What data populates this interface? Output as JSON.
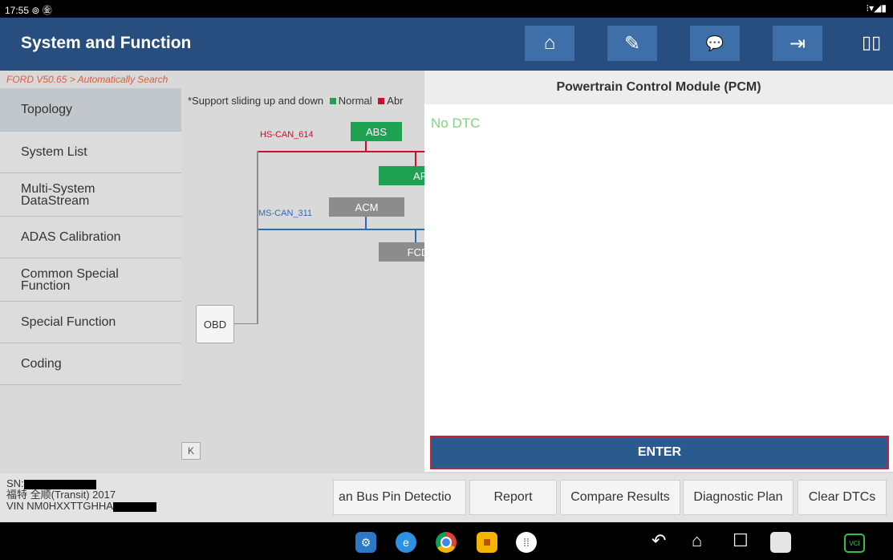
{
  "status_bar": {
    "time": "17:55 ⊚ ㊎",
    "indicators": "⁝▾◢▮"
  },
  "header": {
    "title": "System and Function",
    "buttons": [
      {
        "name": "home-icon",
        "glyph": "⌂"
      },
      {
        "name": "edit-icon",
        "glyph": "✎"
      },
      {
        "name": "chat-icon",
        "glyph": "💬"
      },
      {
        "name": "exit-icon",
        "glyph": "⇥"
      }
    ],
    "split_glyph": "▯▯"
  },
  "breadcrumb": "FORD V50.65 > Automatically Search",
  "sidebar": {
    "items": [
      {
        "label": "Topology"
      },
      {
        "label": "System List"
      },
      {
        "label": "Multi-System DataStream"
      },
      {
        "label": "ADAS Calibration"
      },
      {
        "label": "Common Special Function"
      },
      {
        "label": "Special Function"
      },
      {
        "label": "Coding"
      }
    ]
  },
  "topology": {
    "note": "*Support sliding up and down",
    "legend_normal": "Normal",
    "legend_abnormal": "Abr",
    "hs_can": "HS-CAN_614",
    "ms_can": "MS-CAN_311",
    "nodes": {
      "abs": "ABS",
      "api": "API",
      "acm": "ACM",
      "fcd": "FCDI",
      "obd": "OBD"
    },
    "collapse_label": "K",
    "colors": {
      "normal": "#1fa154",
      "abnormal": "#c8102e",
      "offline": "#8c8c8c",
      "hs_line": "#c8102e",
      "ms_line": "#2f6bb3"
    }
  },
  "panel": {
    "title": "Powertrain Control Module (PCM)",
    "status": "No DTC",
    "enter_label": "ENTER"
  },
  "vehicle": {
    "sn_label": "SN:",
    "model": "福特 全顺(Transit) 2017",
    "vin": "VIN NM0HXXTTGHHA"
  },
  "footer_buttons": [
    {
      "label": "an Bus Pin Detectio"
    },
    {
      "label": "Report"
    },
    {
      "label": "Compare Results"
    },
    {
      "label": "Diagnostic Plan"
    },
    {
      "label": "Clear DTCs"
    }
  ],
  "nav": {
    "back": "↶",
    "home": "⌂",
    "recent": "☐"
  }
}
